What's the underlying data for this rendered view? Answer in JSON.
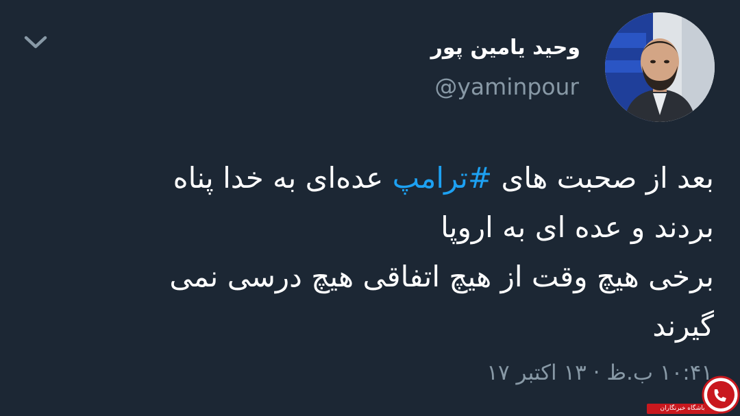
{
  "tweet": {
    "author": {
      "display_name": "وحید یامین پور",
      "handle": "@yaminpour"
    },
    "text": {
      "line1_before": "بعد از صحبت های ",
      "hashtag": "#ترامپ",
      "line1_after": " عده‌ای به خدا پناه",
      "line2": "بردند و عده ای به اروپا",
      "line3": "برخی هیچ وقت از هیچ اتفاقی هیچ درسی نمی",
      "line4": "گیرند"
    },
    "timestamp": "۱۰:۴۱ ب.ظ · ۱۳ اکتبر ۱۷"
  },
  "icons": {
    "menu": "chevron-down-icon",
    "watermark_logo": "phone-logo-icon"
  },
  "watermark": {
    "label": "باشگاه خبرنگاران"
  },
  "colors": {
    "background": "#1c2734",
    "text": "#ffffff",
    "secondary_text": "#8899a6",
    "hashtag": "#1da1f2",
    "watermark_red": "#c9181e"
  }
}
